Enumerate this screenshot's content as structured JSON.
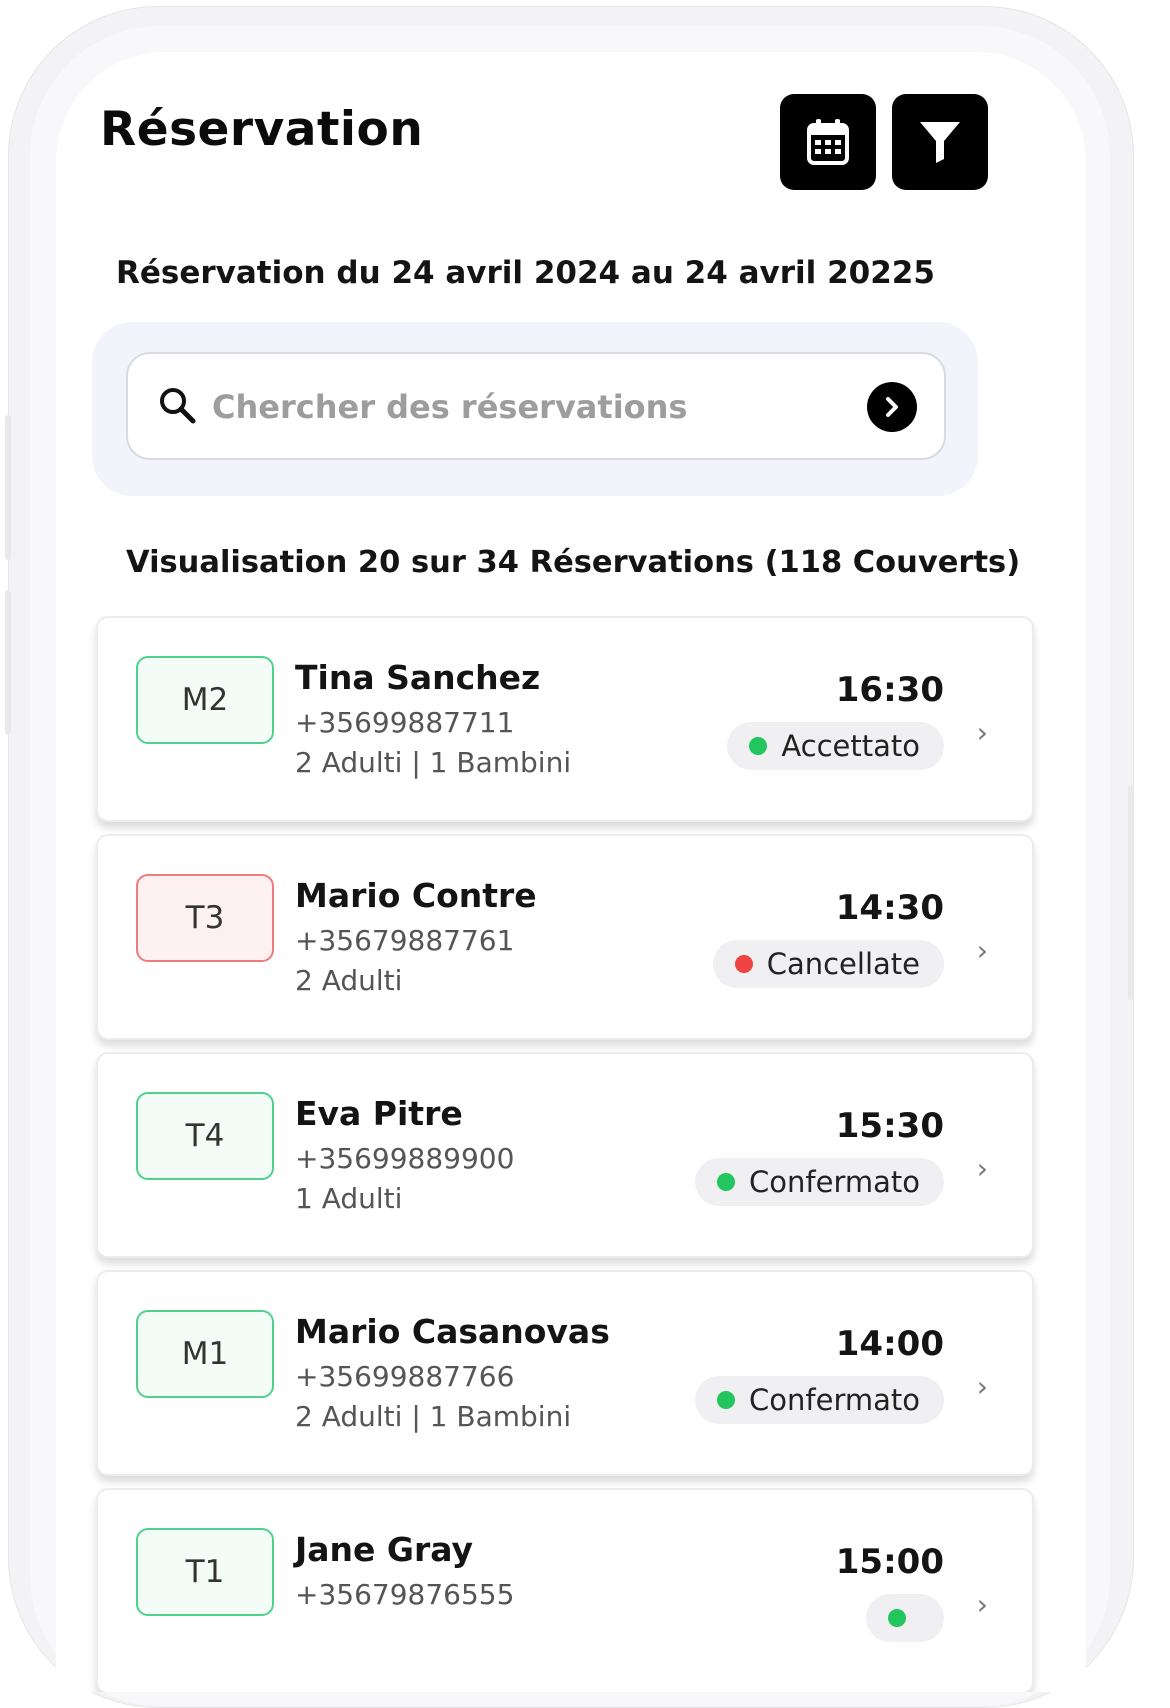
{
  "header": {
    "title": "Réservation",
    "calendar_icon": "calendar-icon",
    "filter_icon": "filter-icon"
  },
  "date_range_text": "Réservation du 24 avril 2024 au 24 avril 20225",
  "search": {
    "placeholder": "Chercher des réservations",
    "value": "",
    "search_icon": "search-icon",
    "go_icon": "chevron-right-circle-icon"
  },
  "summary_text": "Visualisation 20 sur 34 Réservations (118 Couverts)",
  "reservations": [
    {
      "table": "M2",
      "name": "Tina Sanchez",
      "phone": "+35699887711",
      "covers": "2 Adulti | 1 Bambini",
      "time": "16:30",
      "status": "Accettato",
      "status_color": "#22c55e"
    },
    {
      "table": "T3",
      "name": "Mario Contre",
      "phone": "+35679887761",
      "covers": "2 Adulti",
      "time": "14:30",
      "status": "Cancellate",
      "status_color": "#ef4444"
    },
    {
      "table": "T4",
      "name": "Eva Pitre",
      "phone": "+35699889900",
      "covers": "1 Adulti",
      "time": "15:30",
      "status": "Confermato",
      "status_color": "#22c55e"
    },
    {
      "table": "M1",
      "name": "Mario Casanovas",
      "phone": "+35699887766",
      "covers": "2 Adulti | 1 Bambini",
      "time": "14:00",
      "status": "Confermato",
      "status_color": "#22c55e"
    },
    {
      "table": "T1",
      "name": "Jane Gray",
      "phone": "+35679876555",
      "covers": "",
      "time": "15:00",
      "status": "",
      "status_color": "#22c55e"
    }
  ]
}
